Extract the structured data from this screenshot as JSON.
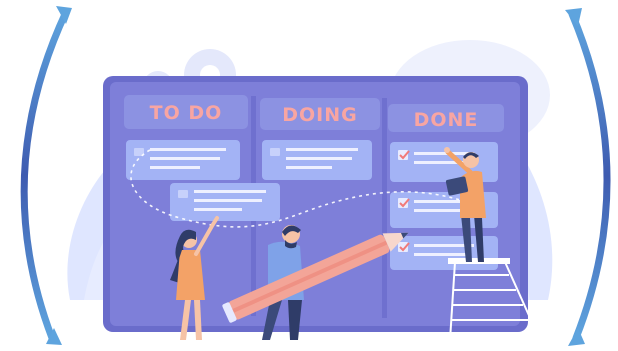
{
  "board": {
    "columns": [
      {
        "title": "TO DO"
      },
      {
        "title": "DOING"
      },
      {
        "title": "DONE"
      }
    ]
  },
  "colors": {
    "board": "#7e7fd9",
    "board_outline": "#6a6ccb",
    "header_text": "#f8a5a2",
    "card": "#a3b3f5",
    "card_line": "#eef0ff",
    "check": "#f07a7a",
    "foliage": "#dfe6ff",
    "gear": "#e4e8fb",
    "pencil": "#f3a598",
    "arc_arrows": "#3f5fb2"
  },
  "icons": [
    "curved-arrow-icon",
    "gear-icon",
    "checkmark-icon",
    "pencil-icon"
  ]
}
